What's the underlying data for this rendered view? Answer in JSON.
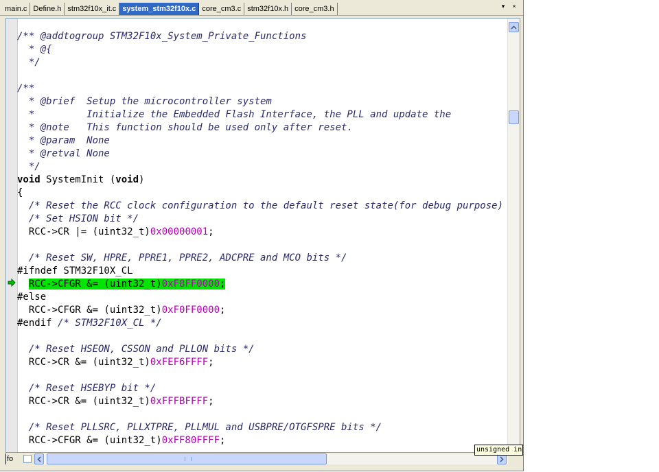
{
  "tabs": [
    {
      "label": "main.c",
      "active": false
    },
    {
      "label": "Define.h",
      "active": false
    },
    {
      "label": "stm32f10x_it.c",
      "active": false
    },
    {
      "label": "system_stm32f10x.c",
      "active": true
    },
    {
      "label": "core_cm3.c",
      "active": false
    },
    {
      "label": "stm32f10x.h",
      "active": false
    },
    {
      "label": "core_cm3.h",
      "active": false
    }
  ],
  "tab_controls": {
    "dropdown_icon": "▾",
    "close_icon": "×"
  },
  "code_lines": [
    [
      {
        "t": "/** @addtogroup STM32F10x_System_Private_Functions",
        "c": "cm"
      }
    ],
    [
      {
        "t": "  * @{",
        "c": "cm"
      }
    ],
    [
      {
        "t": "  */",
        "c": "cm"
      }
    ],
    [],
    [
      {
        "t": "/**",
        "c": "cm"
      }
    ],
    [
      {
        "t": "  * @brief  Setup the microcontroller system",
        "c": "cm"
      }
    ],
    [
      {
        "t": "  *         Initialize the Embedded Flash Interface, the PLL and update the",
        "c": "cm"
      }
    ],
    [
      {
        "t": "  * @note   This function should be used only after reset.",
        "c": "cm"
      }
    ],
    [
      {
        "t": "  * @param  None",
        "c": "cm"
      }
    ],
    [
      {
        "t": "  * @retval None",
        "c": "cm"
      }
    ],
    [
      {
        "t": "  */",
        "c": "cm"
      }
    ],
    [
      {
        "t": "void",
        "c": "kw"
      },
      {
        "t": " SystemInit (",
        "c": ""
      },
      {
        "t": "void",
        "c": "kw"
      },
      {
        "t": ")",
        "c": ""
      }
    ],
    [
      {
        "t": "{",
        "c": ""
      }
    ],
    [
      {
        "t": "  ",
        "c": ""
      },
      {
        "t": "/* Reset the RCC clock configuration to the default reset state(for debug purpose) */",
        "c": "cm"
      }
    ],
    [
      {
        "t": "  ",
        "c": ""
      },
      {
        "t": "/* Set HSION bit */",
        "c": "cm"
      }
    ],
    [
      {
        "t": "  RCC->CR |= (uint32_t)",
        "c": ""
      },
      {
        "t": "0x00000001",
        "c": "num"
      },
      {
        "t": ";",
        "c": ""
      }
    ],
    [],
    [
      {
        "t": "  ",
        "c": ""
      },
      {
        "t": "/* Reset SW, HPRE, PPRE1, PPRE2, ADCPRE and MCO bits */",
        "c": "cm"
      }
    ],
    [
      {
        "t": "#ifndef STM32F10X_CL",
        "c": ""
      }
    ],
    [
      {
        "t": "  ",
        "c": ""
      },
      {
        "t": "RCC->CFGR &= (uint32_t)",
        "c": "hl"
      },
      {
        "t": "0xF8FF0000",
        "c": "hl num"
      },
      {
        "t": ";",
        "c": "hl"
      }
    ],
    [
      {
        "t": "#else",
        "c": ""
      }
    ],
    [
      {
        "t": "  RCC->CFGR &= (uint32_t)",
        "c": ""
      },
      {
        "t": "0xF0FF0000",
        "c": "num"
      },
      {
        "t": ";",
        "c": ""
      }
    ],
    [
      {
        "t": "#endif ",
        "c": ""
      },
      {
        "t": "/* STM32F10X_CL */",
        "c": "cm"
      }
    ],
    [],
    [
      {
        "t": "  ",
        "c": ""
      },
      {
        "t": "/* Reset HSEON, CSSON and PLLON bits */",
        "c": "cm"
      }
    ],
    [
      {
        "t": "  RCC->CR &= (uint32_t)",
        "c": ""
      },
      {
        "t": "0xFEF6FFFF",
        "c": "num"
      },
      {
        "t": ";",
        "c": ""
      }
    ],
    [],
    [
      {
        "t": "  ",
        "c": ""
      },
      {
        "t": "/* Reset HSEBYP bit */",
        "c": "cm"
      }
    ],
    [
      {
        "t": "  RCC->CR &= (uint32_t)",
        "c": ""
      },
      {
        "t": "0xFFFBFFFF",
        "c": "num"
      },
      {
        "t": ";",
        "c": ""
      }
    ],
    [],
    [
      {
        "t": "  ",
        "c": ""
      },
      {
        "t": "/* Reset PLLSRC, PLLXTPRE, PLLMUL and USBPRE/OTGFSPRE bits */",
        "c": "cm"
      }
    ],
    [
      {
        "t": "  RCC->CFGR &= (uint32_t)",
        "c": ""
      },
      {
        "t": "0xFF80FFFF",
        "c": "num"
      },
      {
        "t": ";",
        "c": ""
      }
    ]
  ],
  "current_line_index": 19,
  "status": {
    "fo_label": "fo"
  },
  "tooltip": {
    "text": "unsigned int"
  },
  "colors": {
    "active_tab": "#316ac5",
    "highlight": "#00e400",
    "comment": "#2a2a6a",
    "number": "#b000b0",
    "execution_arrow": "#00c000"
  },
  "icons": {
    "execution_arrow": "arrow-right-icon",
    "scroll_up": "chevron-up-icon",
    "scroll_left": "chevron-left-icon",
    "scroll_right": "chevron-right-icon"
  }
}
